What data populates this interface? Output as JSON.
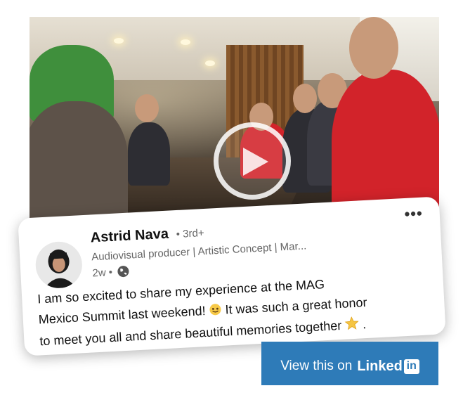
{
  "post": {
    "author_name": "Astrid Nava",
    "degree": "• 3rd+",
    "headline": "Audiovisual producer | Artistic Concept | Mar...",
    "time": "2w •",
    "more_label": "•••",
    "text_line1": "I am so excited to share my experience at the MAG",
    "text_line2a": "Mexico Summit last weekend!",
    "text_line2b": "It was such a great honor",
    "text_line3a": "to meet  you all and share beautiful memories together",
    "text_line3b": "."
  },
  "cta": {
    "prefix": "View this on",
    "brand_text": "Linked",
    "brand_box": "in",
    "color": "#2e7bb8"
  },
  "icons": {
    "globe": "globe-icon",
    "play": "play-icon",
    "smile": "smiling-face-emoji-icon",
    "star": "star-emoji-icon"
  }
}
